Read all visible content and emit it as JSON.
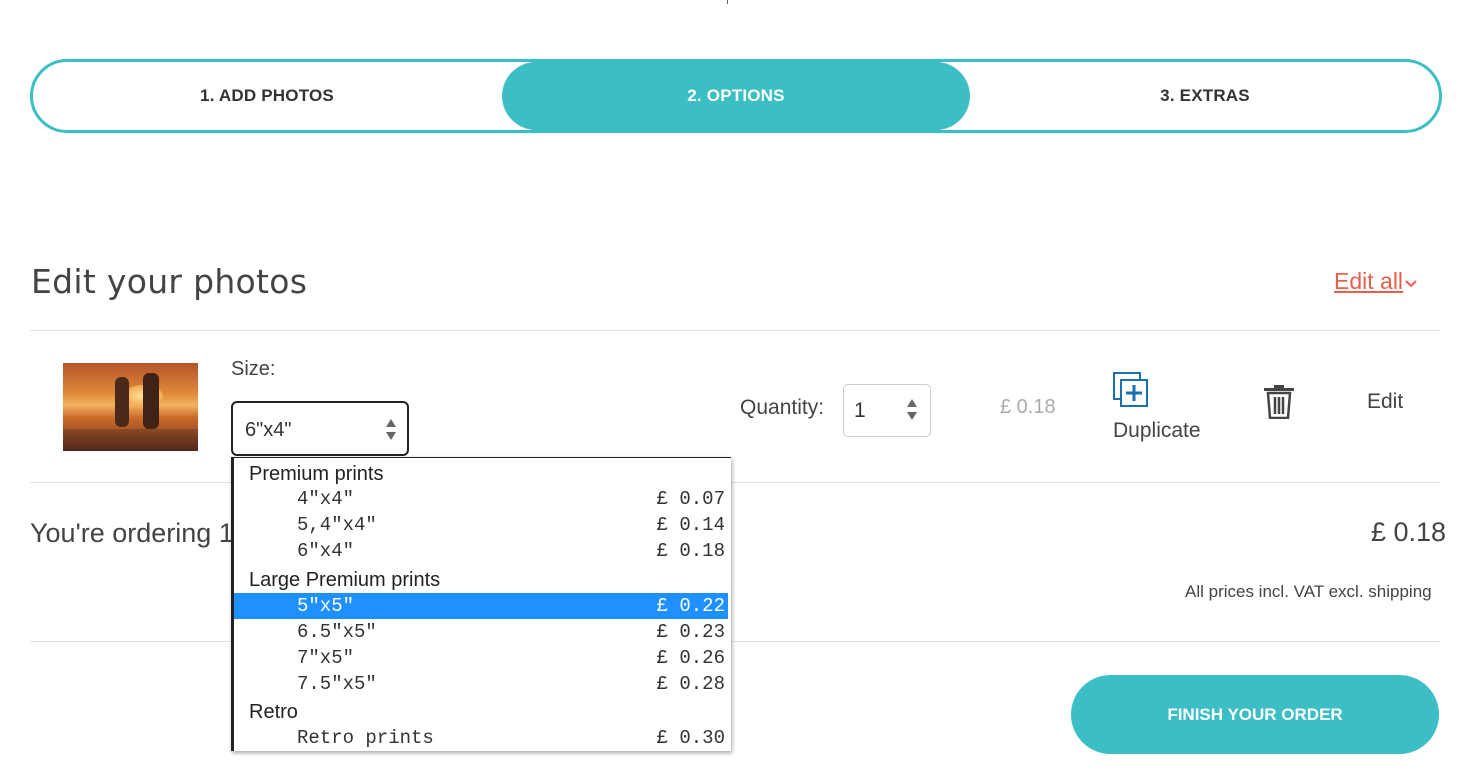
{
  "steps": [
    {
      "label": "1. ADD PHOTOS"
    },
    {
      "label": "2. OPTIONS"
    },
    {
      "label": "3. EXTRAS"
    }
  ],
  "section": {
    "title": "Edit your photos",
    "edit_all": "Edit all"
  },
  "item": {
    "size_label": "Size:",
    "size_value": "6\"x4\"",
    "quantity_label": "Quantity:",
    "quantity_value": "1",
    "price": "£ 0.18",
    "duplicate_label": "Duplicate",
    "edit_label": "Edit"
  },
  "summary": {
    "ordering_text": "You're ordering 1",
    "total": "£ 0.18",
    "vat_note": "All prices incl. VAT excl. shipping",
    "finish_button": "FINISH YOUR ORDER"
  },
  "dropdown": {
    "groups": [
      {
        "label": "Premium prints",
        "options": [
          {
            "name": "4\"x4\"",
            "price": "£ 0.07"
          },
          {
            "name": "5,4\"x4\"",
            "price": "£ 0.14"
          },
          {
            "name": "6\"x4\"",
            "price": "£ 0.18"
          }
        ]
      },
      {
        "label": "Large Premium prints",
        "options": [
          {
            "name": "5\"x5\"",
            "price": "£ 0.22"
          },
          {
            "name": "6.5\"x5\"",
            "price": "£ 0.23"
          },
          {
            "name": "7\"x5\"",
            "price": "£ 0.26"
          },
          {
            "name": "7.5\"x5\"",
            "price": "£ 0.28"
          }
        ]
      },
      {
        "label": "Retro",
        "options": [
          {
            "name": "Retro prints",
            "price": "£ 0.30"
          }
        ]
      }
    ],
    "selected_option": "5\"x5\""
  },
  "colors": {
    "accent": "#3bbec4",
    "link": "#e8604c",
    "selection": "#1e90ff"
  },
  "icons": {
    "duplicate": "duplicate-plus-icon",
    "delete": "trash-icon",
    "edit_all": "chevron-down-icon"
  }
}
